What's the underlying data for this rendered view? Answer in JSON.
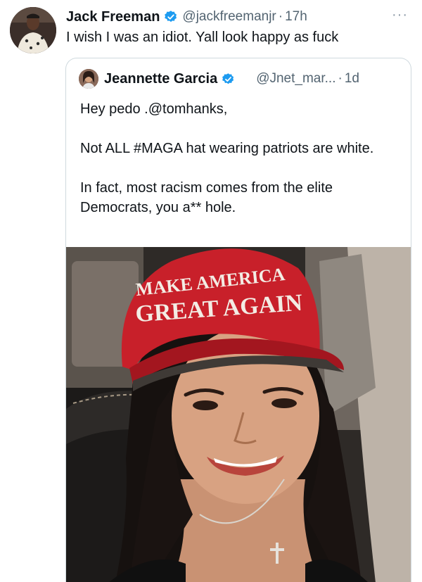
{
  "tweet": {
    "author_name": "Jack Freeman",
    "author_handle": "@jackfreemanjr",
    "separator": "·",
    "time": "17h",
    "more_icon": "···",
    "text": "I wish I was an idiot. Yall look happy as fuck"
  },
  "quoted": {
    "author_name": "Jeannette Garcia",
    "author_handle": "@Jnet_mar...",
    "separator": "·",
    "time": "1d",
    "paragraphs": [
      "Hey pedo .@tomhanks,",
      "Not ALL #MAGA hat wearing patriots are white.",
      "In fact,  most racism comes from the elite Democrats, you a** hole."
    ],
    "hat_text_top": "MAKE AMERICA",
    "hat_text_bottom": "GREAT AGAIN"
  },
  "colors": {
    "verified_blue": "#1d9bf0",
    "secondary_text": "#536471",
    "border": "#cfd9de",
    "hat_red": "#c8202a"
  },
  "icons": {
    "verified": "verified-badge-icon",
    "more": "more-options-icon",
    "moon": "crescent-moon-icon"
  }
}
